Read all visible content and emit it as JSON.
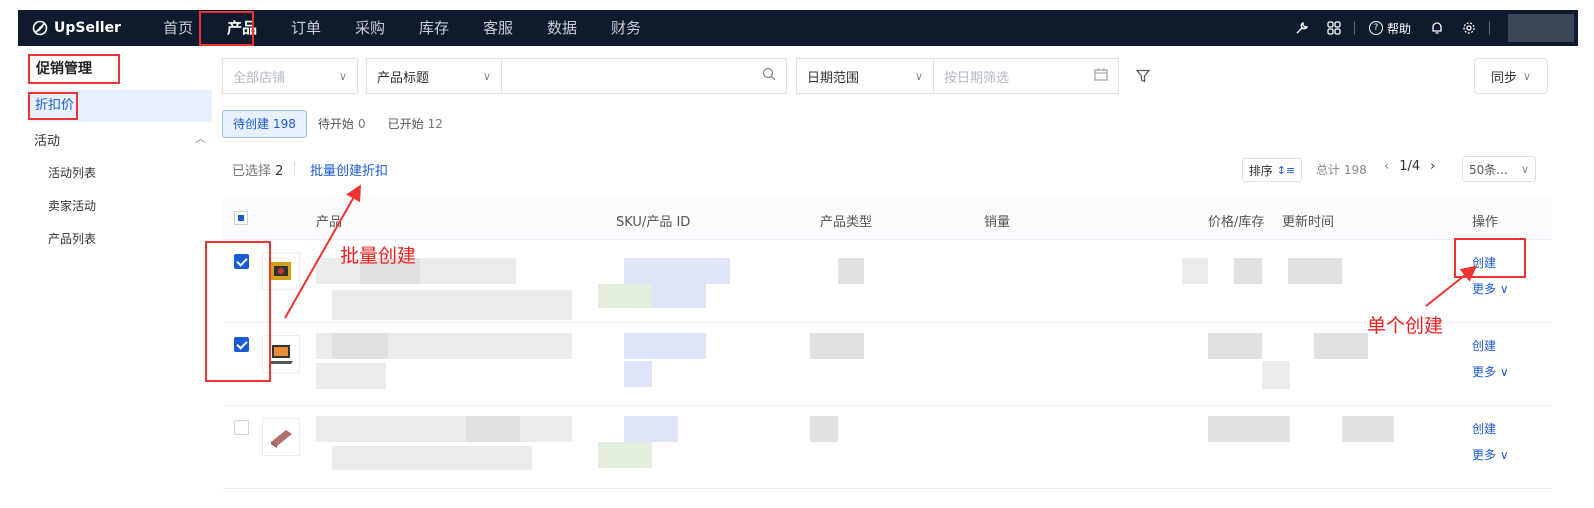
{
  "brand": "UpSeller",
  "nav": {
    "items": [
      "首页",
      "产品",
      "订单",
      "采购",
      "库存",
      "客服",
      "数据",
      "财务"
    ],
    "active_index": 1,
    "help_label": "帮助"
  },
  "sidebar": {
    "title": "促销管理",
    "active_item": "折扣价",
    "group_label": "活动",
    "sub_items": [
      "活动列表",
      "卖家活动",
      "产品列表"
    ]
  },
  "filters": {
    "store_placeholder": "全部店铺",
    "field_select": "产品标题",
    "date_select": "日期范围",
    "date_placeholder": "按日期筛选",
    "sync_label": "同步"
  },
  "tabs": [
    {
      "label": "待创建",
      "count": "198"
    },
    {
      "label": "待开始",
      "count": "0"
    },
    {
      "label": "已开始",
      "count": "12"
    }
  ],
  "toolbar": {
    "selected_prefix": "已选择",
    "selected_count": "2",
    "batch_create": "批量创建折扣",
    "sort_label": "排序",
    "total_label": "总计 198",
    "page_label": "1/4",
    "page_size": "50条..."
  },
  "table": {
    "headers": {
      "product": "产品",
      "sku": "SKU/产品 ID",
      "type": "产品类型",
      "sales": "销量",
      "price_stock": "价格/库存",
      "updated": "更新时间",
      "actions": "操作"
    },
    "rows": [
      {
        "checked": true,
        "create": "创建",
        "more": "更多"
      },
      {
        "checked": true,
        "create": "创建",
        "more": "更多"
      },
      {
        "checked": false,
        "create": "创建",
        "more": "更多"
      }
    ]
  },
  "annotations": {
    "batch": "批量创建",
    "single": "单个创建",
    "color": "#e33333"
  },
  "colors": {
    "nav_bg": "#0f1a2e",
    "accent": "#1a5bd6"
  }
}
